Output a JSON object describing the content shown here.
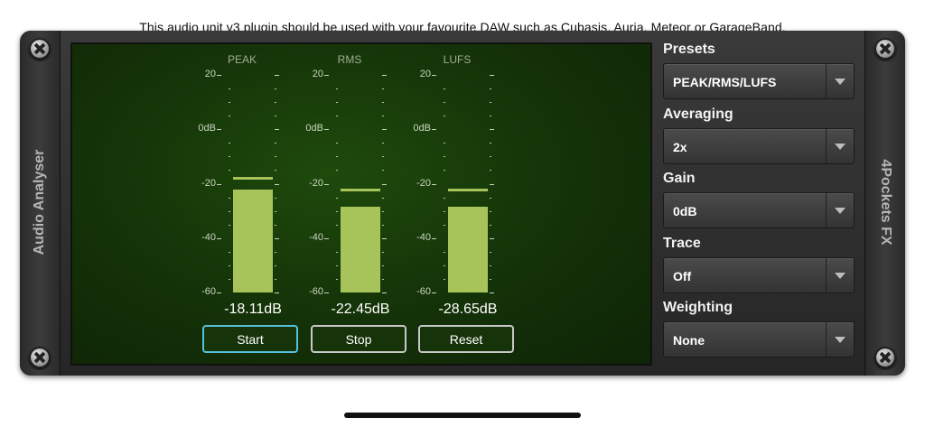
{
  "caption": "This audio unit v3 plugin should be used with your favourite DAW such as Cubasis, Auria, Meteor or GarageBand.",
  "left_rail_label": "Audio Analyser",
  "right_rail_label": "4Pockets FX",
  "meters": [
    {
      "title": "PEAK",
      "value_db": -22.0,
      "peak_db": -18.11,
      "readout": "-18.11dB"
    },
    {
      "title": "RMS",
      "value_db": -28.5,
      "peak_db": -22.45,
      "readout": "-22.45dB"
    },
    {
      "title": "LUFS",
      "value_db": -28.5,
      "peak_db": -22.45,
      "readout": "-28.65dB"
    }
  ],
  "scale_labels": [
    "20",
    "0dB",
    "-20",
    "-40",
    "-60"
  ],
  "buttons": {
    "start": "Start",
    "stop": "Stop",
    "reset": "Reset"
  },
  "settings": [
    {
      "label": "Presets",
      "value": "PEAK/RMS/LUFS"
    },
    {
      "label": "Averaging",
      "value": "2x"
    },
    {
      "label": "Gain",
      "value": "0dB"
    },
    {
      "label": "Trace",
      "value": "Off"
    },
    {
      "label": "Weighting",
      "value": "None"
    }
  ],
  "colors": {
    "bar": "#a6c45a",
    "active_button_border": "#56c0dc"
  }
}
